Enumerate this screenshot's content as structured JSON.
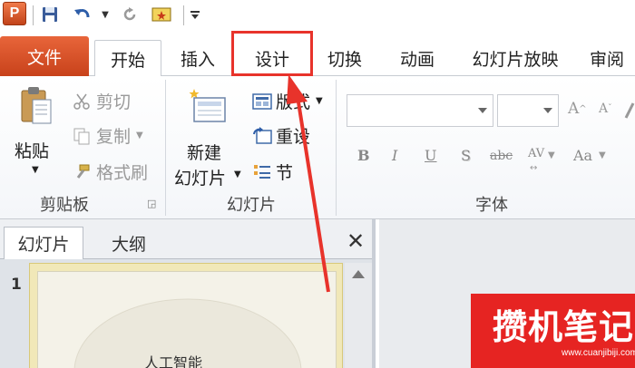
{
  "app": {
    "logo_letter": "P"
  },
  "tabs": [
    {
      "label": "文件"
    },
    {
      "label": "开始"
    },
    {
      "label": "插入"
    },
    {
      "label": "设计"
    },
    {
      "label": "切换"
    },
    {
      "label": "动画"
    },
    {
      "label": "幻灯片放映"
    },
    {
      "label": "审阅"
    }
  ],
  "ribbon": {
    "clipboard": {
      "label": "剪贴板",
      "paste": "粘贴",
      "cut": "剪切",
      "copy": "复制",
      "format_painter": "格式刷"
    },
    "slides": {
      "label": "幻灯片",
      "new_slide_line1": "新建",
      "new_slide_line2": "幻灯片",
      "layout": "版式",
      "reset": "重设",
      "section": "节"
    },
    "font": {
      "label": "字体",
      "bold": "B",
      "italic": "I",
      "underline": "U",
      "shadow": "S",
      "strike": "abc",
      "spacing": "AV",
      "case": "Aa"
    }
  },
  "panel": {
    "tab_slides": "幻灯片",
    "tab_outline": "大纲",
    "slide_number": "1",
    "slide_title": "人工智能"
  },
  "watermark": {
    "text": "攒机笔记",
    "url": "www.cuanjibiji.com"
  },
  "colors": {
    "file_tab": "#d2502a",
    "highlight": "#e8332b",
    "watermark": "#e62422"
  }
}
